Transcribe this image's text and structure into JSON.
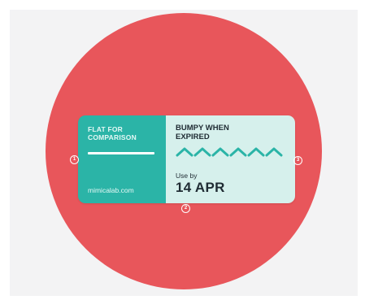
{
  "colors": {
    "background_panel": "#f3f3f4",
    "circle": "#e8565b",
    "label_left": "#2bb4a7",
    "label_right": "#d6f0ec",
    "bumps": "#2bb4a7",
    "text_dark": "#1f2b33"
  },
  "label": {
    "flat_title": "FLAT FOR\nCOMPARISON",
    "site": "mimicalab.com",
    "bumpy_title": "BUMPY WHEN\nEXPIRED",
    "use_by_label": "Use by",
    "use_by_date": "14 APR",
    "bump_count": 6
  },
  "markers": {
    "left": "1",
    "bottom": "2",
    "right": "3"
  }
}
